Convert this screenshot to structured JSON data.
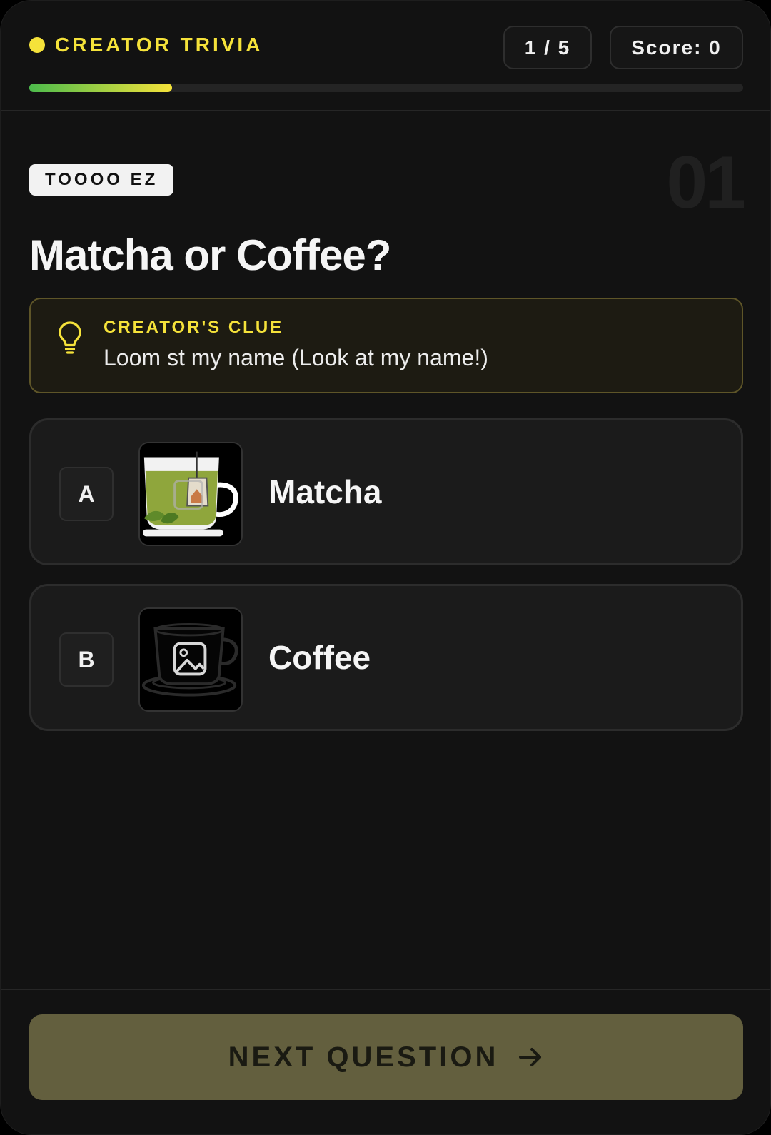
{
  "header": {
    "brand": "CREATOR TRIVIA",
    "progress_text": "1 / 5",
    "score_text": "Score: 0",
    "progress_fraction": 0.2
  },
  "question": {
    "difficulty": "TOOOO EZ",
    "number": "01",
    "text": "Matcha or Coffee?"
  },
  "clue": {
    "title": "CREATOR'S CLUE",
    "text": "Loom st my name (Look at my name!)",
    "icon": "lightbulb-icon"
  },
  "options": [
    {
      "letter": "A",
      "label": "Matcha",
      "image": "matcha-cup-image"
    },
    {
      "letter": "B",
      "label": "Coffee",
      "image": "coffee-cup-image"
    }
  ],
  "footer": {
    "next_label": "NEXT QUESTION",
    "icon": "arrow-right-icon"
  },
  "colors": {
    "accent": "#f5e23a",
    "progress_start": "#4cbb4c",
    "background": "#121212",
    "button": "#635f3e"
  }
}
